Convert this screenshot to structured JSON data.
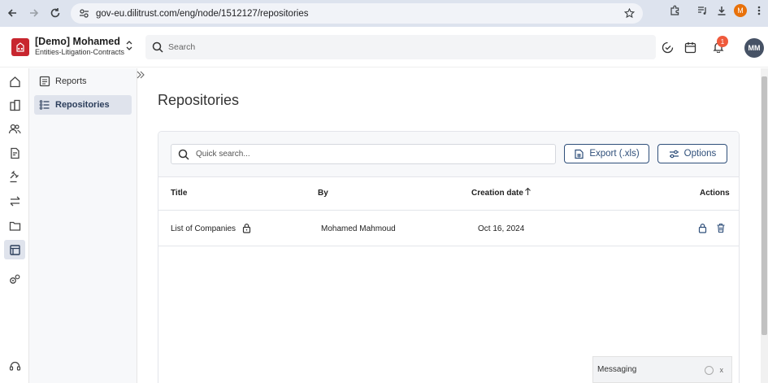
{
  "browser": {
    "url": "gov-eu.dilitrust.com/eng/node/1512127/repositories",
    "profile_initial": "M"
  },
  "header": {
    "org_name": "[Demo] Mohamed",
    "org_subtitle": "Entities-Litigation-Contracts",
    "search_placeholder": "Search",
    "notification_count": "1",
    "avatar_initials": "MM"
  },
  "sidebar": {
    "items": [
      {
        "label": "Reports",
        "icon": "report-icon"
      },
      {
        "label": "Repositories",
        "icon": "list-icon"
      }
    ]
  },
  "main": {
    "page_title": "Repositories",
    "quick_search_placeholder": "Quick search...",
    "export_label": "Export (.xls)",
    "options_label": "Options",
    "columns": {
      "title": "Title",
      "by": "By",
      "creation_date": "Creation date",
      "actions": "Actions"
    },
    "rows": [
      {
        "title": "List of Companies",
        "by": "Mohamed Mahmoud",
        "date": "Oct 16, 2024"
      }
    ]
  },
  "messaging": {
    "label": "Messaging",
    "close": "x"
  },
  "colors": {
    "accent": "#2f4f7a",
    "logo": "#c8262f",
    "badge": "#ef5a3c"
  }
}
